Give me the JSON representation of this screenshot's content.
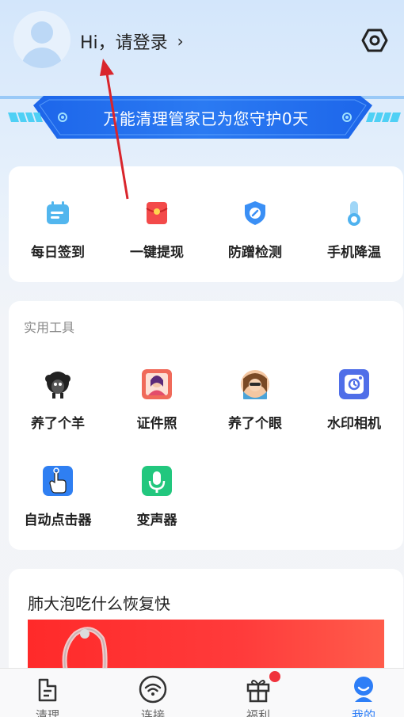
{
  "header": {
    "greeting": "Hi，请登录",
    "chevron": "›"
  },
  "banner": {
    "text": "万能清理管家已为您守护0天"
  },
  "quick_actions": [
    {
      "label": "每日签到",
      "icon": "calendar-icon"
    },
    {
      "label": "一键提现",
      "icon": "red-envelope-icon"
    },
    {
      "label": "防蹭检测",
      "icon": "shield-icon"
    },
    {
      "label": "手机降温",
      "icon": "thermometer-icon"
    }
  ],
  "tools": {
    "title": "实用工具",
    "items": [
      {
        "label": "养了个羊",
        "icon": "sheep-icon"
      },
      {
        "label": "证件照",
        "icon": "id-photo-icon"
      },
      {
        "label": "养了个眼",
        "icon": "eye-photo-icon"
      },
      {
        "label": "水印相机",
        "icon": "watermark-camera-icon"
      },
      {
        "label": "自动点击器",
        "icon": "auto-clicker-icon"
      },
      {
        "label": "变声器",
        "icon": "voice-changer-icon"
      }
    ]
  },
  "article": {
    "title": "肺大泡吃什么恢复快"
  },
  "bottom_nav": [
    {
      "label": "清理",
      "icon": "broom-icon",
      "active": false
    },
    {
      "label": "连接",
      "icon": "wifi-icon",
      "active": false
    },
    {
      "label": "福利",
      "icon": "gift-icon",
      "active": false
    },
    {
      "label": "我的",
      "icon": "profile-icon",
      "active": true
    }
  ],
  "colors": {
    "accent": "#2d7ef7",
    "banner": "#2a6ff0",
    "badge": "#f0323c"
  }
}
